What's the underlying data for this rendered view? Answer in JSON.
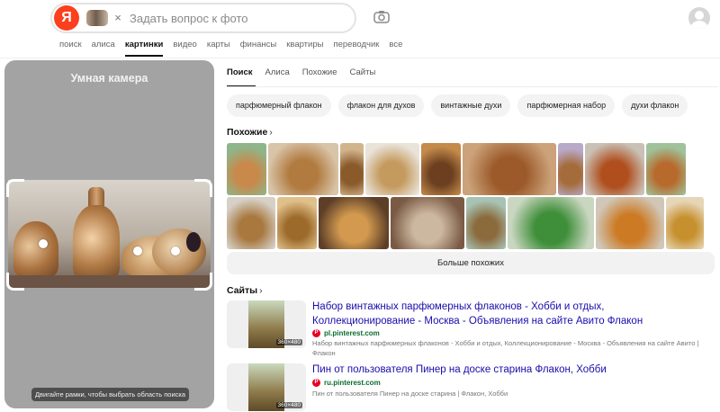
{
  "header": {
    "logo_letter": "Я",
    "search_placeholder": "Задать вопрос к фото",
    "clear_chip_symbol": "×",
    "nav": [
      "поиск",
      "алиса",
      "картинки",
      "видео",
      "карты",
      "финансы",
      "квартиры",
      "переводчик",
      "все"
    ],
    "nav_active_index": 2
  },
  "left_panel": {
    "title": "Умная камера",
    "hint": "Двигайте рамки, чтобы выбрать область поиска"
  },
  "tabs": {
    "items": [
      "Поиск",
      "Алиса",
      "Похожие",
      "Сайты"
    ],
    "active_index": 0
  },
  "chips": [
    "парфюмерный флакон",
    "флакон для духов",
    "винтажные духи",
    "парфюмерная набор",
    "духи флакон"
  ],
  "similar": {
    "title": "Похожие",
    "arrow": "›",
    "row1": [
      {
        "w": 44,
        "c1": "#8fb58a",
        "c2": "#c8894a"
      },
      {
        "w": 78,
        "c1": "#d8c4a8",
        "c2": "#b17a3f"
      },
      {
        "w": 26,
        "c1": "#d2b48c",
        "c2": "#8a5a2b"
      },
      {
        "w": 60,
        "c1": "#e9e3da",
        "c2": "#c59a5e"
      },
      {
        "w": 44,
        "c1": "#c48a4a",
        "c2": "#6b3f1f"
      },
      {
        "w": 104,
        "c1": "#cba27a",
        "c2": "#9c5a2a"
      },
      {
        "w": 28,
        "c1": "#b8a9c9",
        "c2": "#a56c3b"
      },
      {
        "w": 66,
        "c1": "#c9c1b6",
        "c2": "#b04e1d"
      },
      {
        "w": 44,
        "c1": "#9fc29a",
        "c2": "#b86a2c"
      }
    ],
    "row2": [
      {
        "w": 54,
        "c1": "#d6d0c6",
        "c2": "#a8783f"
      },
      {
        "w": 44,
        "c1": "#e0c08a",
        "c2": "#9c6a2a"
      },
      {
        "w": 78,
        "c1": "#5d3f28",
        "c2": "#d39a4f"
      },
      {
        "w": 82,
        "c1": "#7a5a44",
        "c2": "#ccb7a0"
      },
      {
        "w": 44,
        "c1": "#a7c3b4",
        "c2": "#8b6a3c"
      },
      {
        "w": 96,
        "c1": "#c9d6c0",
        "c2": "#3f8f3a"
      },
      {
        "w": 76,
        "c1": "#d0c7b8",
        "c2": "#cc7a24"
      },
      {
        "w": 42,
        "c1": "#e6d6b8",
        "c2": "#c7902f"
      }
    ],
    "more_label": "Больше похожих"
  },
  "sites": {
    "title": "Сайты",
    "arrow": "›",
    "results": [
      {
        "title": "Набор винтажных парфюмерных флаконов - Хобби и отдых, Коллекционирование - Москва - Объявления на сайте Авито Флакон",
        "source": "pl.pinterest.com",
        "desc": "Набор винтажных парфюмерных флаконов - Хобби и отдых, Коллекционирование - Москва - Объявления на сайте Авито | Флакон",
        "size": "360×480"
      },
      {
        "title": "Пин от пользователя Пинер на доске старина Флакон, Хобби",
        "source": "ru.pinterest.com",
        "desc": "Пин от пользователя Пинер на доске старина | Флакон, Хобби",
        "size": "360×480"
      }
    ]
  },
  "icons": {
    "camera": "camera-icon",
    "pinterest": "P"
  }
}
